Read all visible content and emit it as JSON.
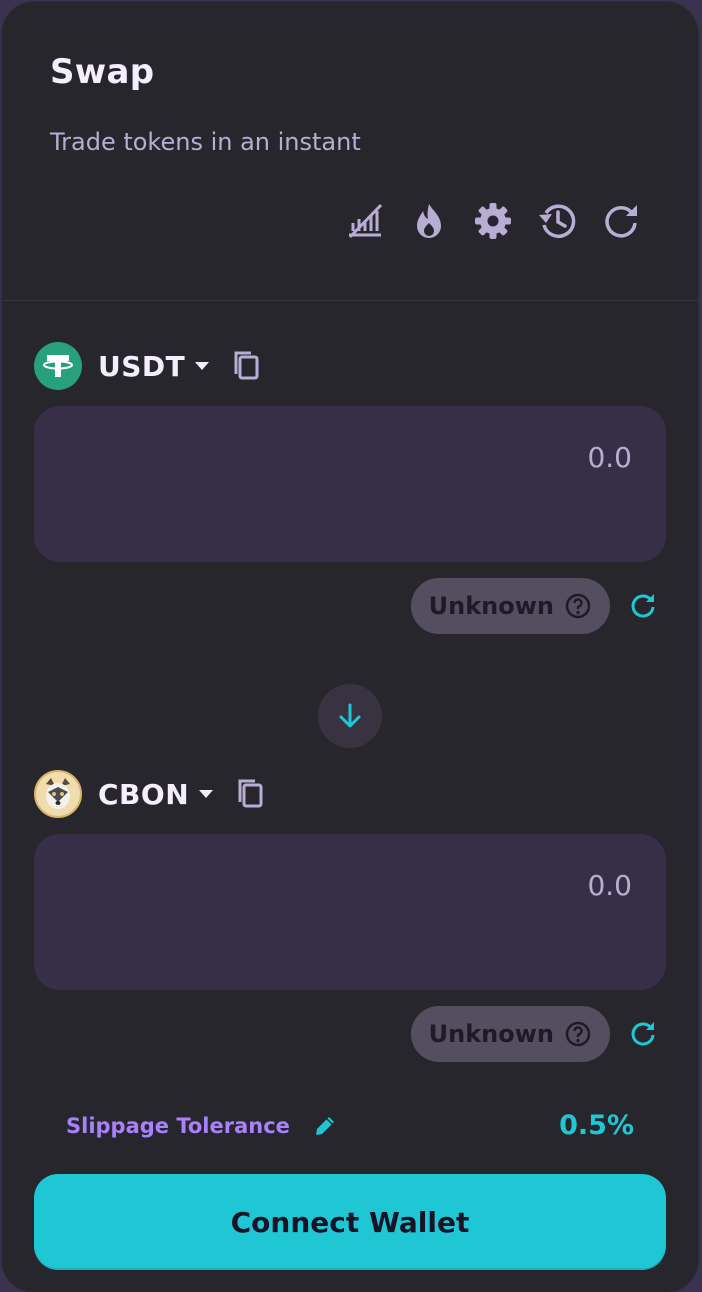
{
  "header": {
    "title": "Swap",
    "subtitle": "Trade tokens in an instant",
    "toolbar_icons": [
      "chart-disabled-icon",
      "fire-icon",
      "gear-icon",
      "history-icon",
      "refresh-icon"
    ]
  },
  "from": {
    "symbol": "USDT",
    "amount_placeholder": "0.0",
    "price_label": "Unknown",
    "logo": "usdt-logo-icon"
  },
  "to": {
    "symbol": "CBON",
    "amount_placeholder": "0.0",
    "price_label": "Unknown",
    "logo": "cbon-logo-icon"
  },
  "slippage": {
    "label": "Slippage Tolerance",
    "value": "0.5%"
  },
  "actions": {
    "connect_label": "Connect Wallet"
  },
  "colors": {
    "accent": "#1fc7d4",
    "secondary": "#a881fc",
    "card": "#27262c",
    "input": "#372f47",
    "usdt": "#26a17b"
  }
}
